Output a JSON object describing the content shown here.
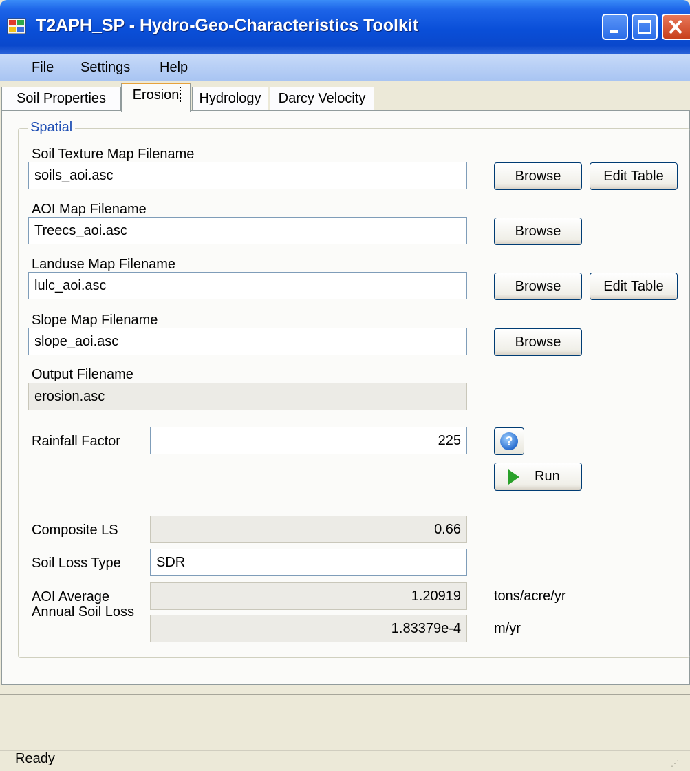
{
  "window": {
    "title": "T2APH_SP - Hydro-Geo-Characteristics Toolkit"
  },
  "menu": [
    "File",
    "Settings",
    "Help"
  ],
  "tabs": [
    "Soil Properties",
    "Erosion",
    "Hydrology",
    "Darcy Velocity"
  ],
  "active_tab": "Erosion",
  "spatial": {
    "group_label": "Spatial",
    "soil_texture": {
      "label": "Soil Texture Map Filename",
      "value": "soils_aoi.asc"
    },
    "aoi": {
      "label": "AOI Map Filename",
      "value": "Treecs_aoi.asc"
    },
    "landuse": {
      "label": "Landuse Map Filename",
      "value": "lulc_aoi.asc"
    },
    "slope": {
      "label": "Slope Map Filename",
      "value": "slope_aoi.asc"
    },
    "output": {
      "label": "Output Filename",
      "value": "erosion.asc"
    },
    "browse_label": "Browse",
    "edit_table_label": "Edit Table",
    "rainfall": {
      "label": "Rainfall Factor",
      "value": "225"
    },
    "run_label": "Run",
    "composite_ls": {
      "label": "Composite LS",
      "value": "0.66"
    },
    "soil_loss_type": {
      "label": "Soil Loss Type",
      "value": "SDR"
    },
    "avg_soil_loss": {
      "label_line1": "AOI Average",
      "label_line2": "Annual Soil Loss",
      "value_tons": "1.20919",
      "unit_tons": "tons/acre/yr",
      "value_m": "1.83379e-4",
      "unit_m": "m/yr"
    }
  },
  "status": {
    "text": "Ready"
  },
  "icons": {
    "app": "app-icon",
    "help": "help-icon",
    "run": "play-icon",
    "dropdown": "chevron-down-icon"
  }
}
